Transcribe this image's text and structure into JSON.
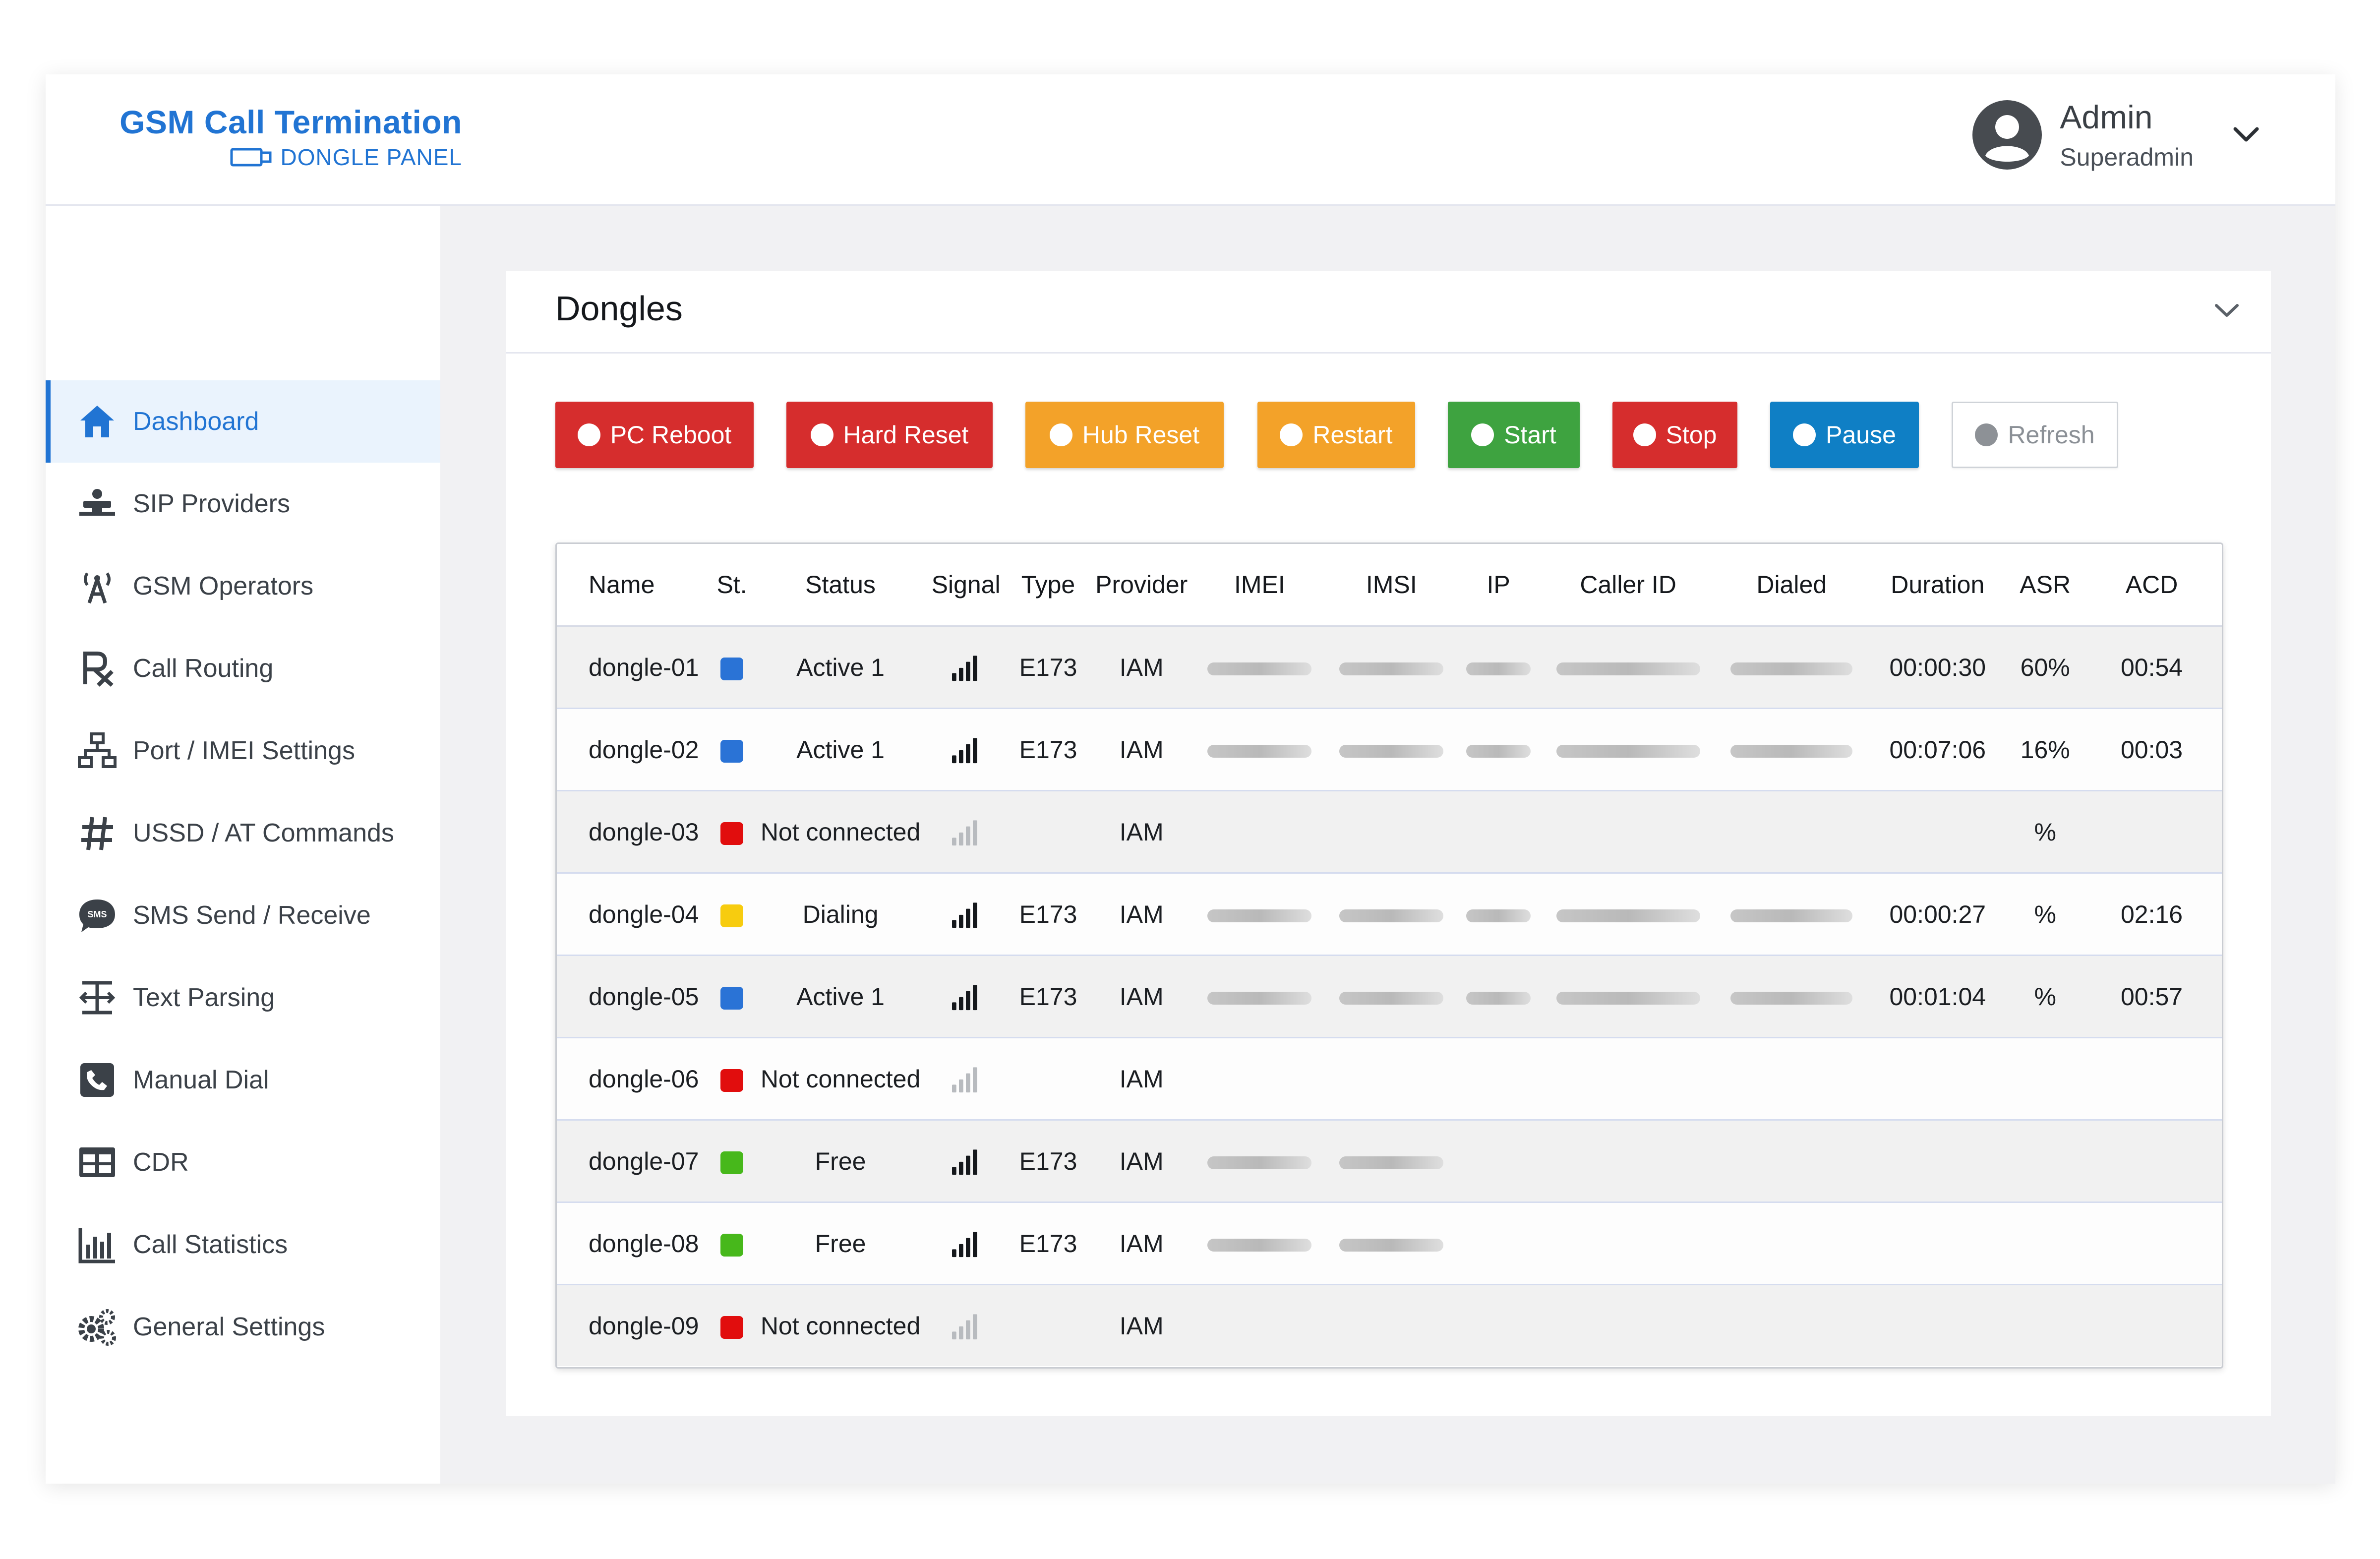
{
  "brand": {
    "title": "GSM Call Termination",
    "subtitle": "DONGLE PANEL",
    "color": "#2174d3"
  },
  "user": {
    "name": "Admin",
    "role": "Superadmin"
  },
  "sidebar": {
    "items": [
      {
        "label": "Dashboard",
        "icon": "home-icon",
        "active": true
      },
      {
        "label": "SIP Providers",
        "icon": "sip-provider-icon"
      },
      {
        "label": "GSM Operators",
        "icon": "antenna-icon"
      },
      {
        "label": "Call Routing",
        "icon": "routing-icon"
      },
      {
        "label": "Port / IMEI Settings",
        "icon": "network-icon"
      },
      {
        "label": "USSD / AT Commands",
        "icon": "hash-icon"
      },
      {
        "label": "SMS Send / Receive",
        "icon": "sms-bubble-icon"
      },
      {
        "label": "Text Parsing",
        "icon": "text-parse-icon"
      },
      {
        "label": "Manual Dial",
        "icon": "phone-icon"
      },
      {
        "label": "CDR",
        "icon": "table-icon"
      },
      {
        "label": "Call Statistics",
        "icon": "bar-chart-icon"
      },
      {
        "label": "General Settings",
        "icon": "gears-icon"
      }
    ]
  },
  "panel": {
    "title": "Dongles"
  },
  "actions": [
    {
      "label": "PC Reboot",
      "variant": "red"
    },
    {
      "label": "Hard Reset",
      "variant": "red"
    },
    {
      "label": "Hub Reset",
      "variant": "orange"
    },
    {
      "label": "Restart",
      "variant": "orange"
    },
    {
      "label": "Start",
      "variant": "green"
    },
    {
      "label": "Stop",
      "variant": "red"
    },
    {
      "label": "Pause",
      "variant": "blue"
    },
    {
      "label": "Refresh",
      "variant": "light"
    }
  ],
  "table": {
    "columns": [
      "Name",
      "St.",
      "Status",
      "Signal",
      "Type",
      "Provider",
      "IMEI",
      "IMSI",
      "IP",
      "Caller ID",
      "Dialed",
      "Duration",
      "ASR",
      "ACD"
    ],
    "rows": [
      {
        "name": "dongle-01",
        "st_color": "#2a73d6",
        "status": "Active 1",
        "signal": "strong",
        "type": "E173",
        "provider": "IAM",
        "redacted": 5,
        "duration": "00:00:30",
        "asr": "60%",
        "acd": "00:54"
      },
      {
        "name": "dongle-02",
        "st_color": "#2a73d6",
        "status": "Active 1",
        "signal": "strong",
        "type": "E173",
        "provider": "IAM",
        "redacted": 5,
        "duration": "00:07:06",
        "asr": "16%",
        "acd": "00:03"
      },
      {
        "name": "dongle-03",
        "st_color": "#e10d0d",
        "status": "Not connected",
        "signal": "weak",
        "type": "",
        "provider": "IAM",
        "redacted": 0,
        "duration": "",
        "asr": "%",
        "acd": ""
      },
      {
        "name": "dongle-04",
        "st_color": "#f7cc0f",
        "status": "Dialing",
        "signal": "strong",
        "type": "E173",
        "provider": "IAM",
        "redacted": 5,
        "duration": "00:00:27",
        "asr": "%",
        "acd": "02:16"
      },
      {
        "name": "dongle-05",
        "st_color": "#2a73d6",
        "status": "Active 1",
        "signal": "strong",
        "type": "E173",
        "provider": "IAM",
        "redacted": 5,
        "duration": "00:01:04",
        "asr": "%",
        "acd": "00:57"
      },
      {
        "name": "dongle-06",
        "st_color": "#e10d0d",
        "status": "Not connected",
        "signal": "weak",
        "type": "",
        "provider": "IAM",
        "redacted": 0,
        "duration": "",
        "asr": "",
        "acd": ""
      },
      {
        "name": "dongle-07",
        "st_color": "#47b81b",
        "status": "Free",
        "signal": "strong",
        "type": "E173",
        "provider": "IAM",
        "redacted": 2,
        "duration": "",
        "asr": "",
        "acd": ""
      },
      {
        "name": "dongle-08",
        "st_color": "#47b81b",
        "status": "Free",
        "signal": "strong",
        "type": "E173",
        "provider": "IAM",
        "redacted": 2,
        "duration": "",
        "asr": "",
        "acd": ""
      },
      {
        "name": "dongle-09",
        "st_color": "#e10d0d",
        "status": "Not connected",
        "signal": "weak",
        "type": "",
        "provider": "IAM",
        "redacted": 0,
        "duration": "",
        "asr": "",
        "acd": ""
      }
    ]
  },
  "colors": {
    "accent": "#2174d3",
    "red": "#d62d2d",
    "orange": "#f3a229",
    "green": "#3ea340",
    "blue": "#0f7fc5"
  }
}
